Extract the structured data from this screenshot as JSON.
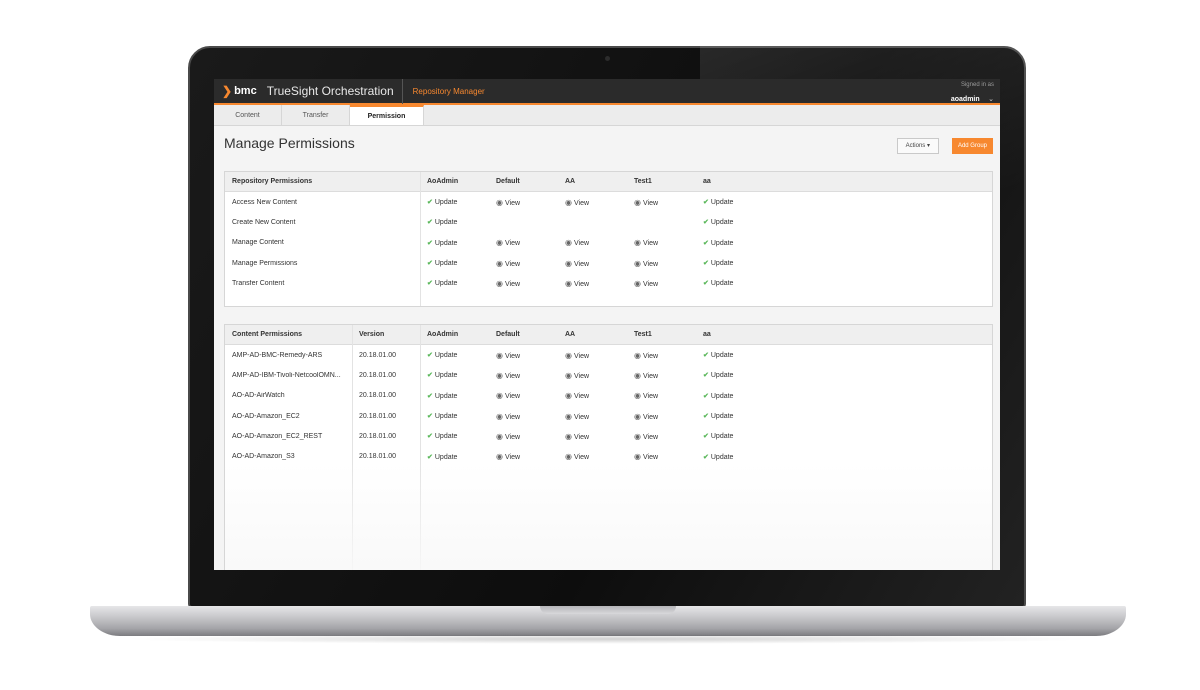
{
  "header": {
    "logo_text": "bmc",
    "product": "TrueSight Orchestration",
    "app": "Repository Manager",
    "signed_in_label": "Signed in as",
    "user": "aoadmin"
  },
  "tabs": [
    {
      "label": "Content"
    },
    {
      "label": "Transfer"
    },
    {
      "label": "Permission"
    }
  ],
  "page": {
    "title": "Manage Permissions",
    "actions_label": "Actions",
    "add_group_label": "Add Group"
  },
  "repo": {
    "headers": [
      "Repository Permissions",
      "AoAdmin",
      "Default",
      "AA",
      "Test1",
      "aa"
    ],
    "rows": [
      {
        "name": "Access New Content",
        "perms": [
          "Update",
          "View",
          "View",
          "View",
          "Update"
        ]
      },
      {
        "name": "Create New Content",
        "perms": [
          "Update",
          "",
          "",
          "",
          "Update"
        ]
      },
      {
        "name": "Manage Content",
        "perms": [
          "Update",
          "View",
          "View",
          "View",
          "Update"
        ]
      },
      {
        "name": "Manage Permissions",
        "perms": [
          "Update",
          "View",
          "View",
          "View",
          "Update"
        ]
      },
      {
        "name": "Transfer Content",
        "perms": [
          "Update",
          "View",
          "View",
          "View",
          "Update"
        ]
      }
    ]
  },
  "content": {
    "headers": [
      "Content Permissions",
      "Version",
      "AoAdmin",
      "Default",
      "AA",
      "Test1",
      "aa"
    ],
    "rows": [
      {
        "name": "AMP-AD-BMC-Remedy-ARS",
        "version": "20.18.01.00",
        "perms": [
          "Update",
          "View",
          "View",
          "View",
          "Update"
        ]
      },
      {
        "name": "AMP-AD-IBM-Tivoli-NetcoolOMN...",
        "version": "20.18.01.00",
        "perms": [
          "Update",
          "View",
          "View",
          "View",
          "Update"
        ]
      },
      {
        "name": "AO-AD-AirWatch",
        "version": "20.18.01.00",
        "perms": [
          "Update",
          "View",
          "View",
          "View",
          "Update"
        ]
      },
      {
        "name": "AO-AD-Amazon_EC2",
        "version": "20.18.01.00",
        "perms": [
          "Update",
          "View",
          "View",
          "View",
          "Update"
        ]
      },
      {
        "name": "AO-AD-Amazon_EC2_REST",
        "version": "20.18.01.00",
        "perms": [
          "Update",
          "View",
          "View",
          "View",
          "Update"
        ]
      },
      {
        "name": "AO-AD-Amazon_S3",
        "version": "20.18.01.00",
        "perms": [
          "Update",
          "View",
          "View",
          "View",
          "Update"
        ]
      }
    ]
  },
  "icons": {
    "update": "check-icon",
    "view": "eye-icon"
  },
  "colors": {
    "accent": "#f7882f",
    "check": "#5cb85c",
    "topbar": "#2b2b2b"
  }
}
